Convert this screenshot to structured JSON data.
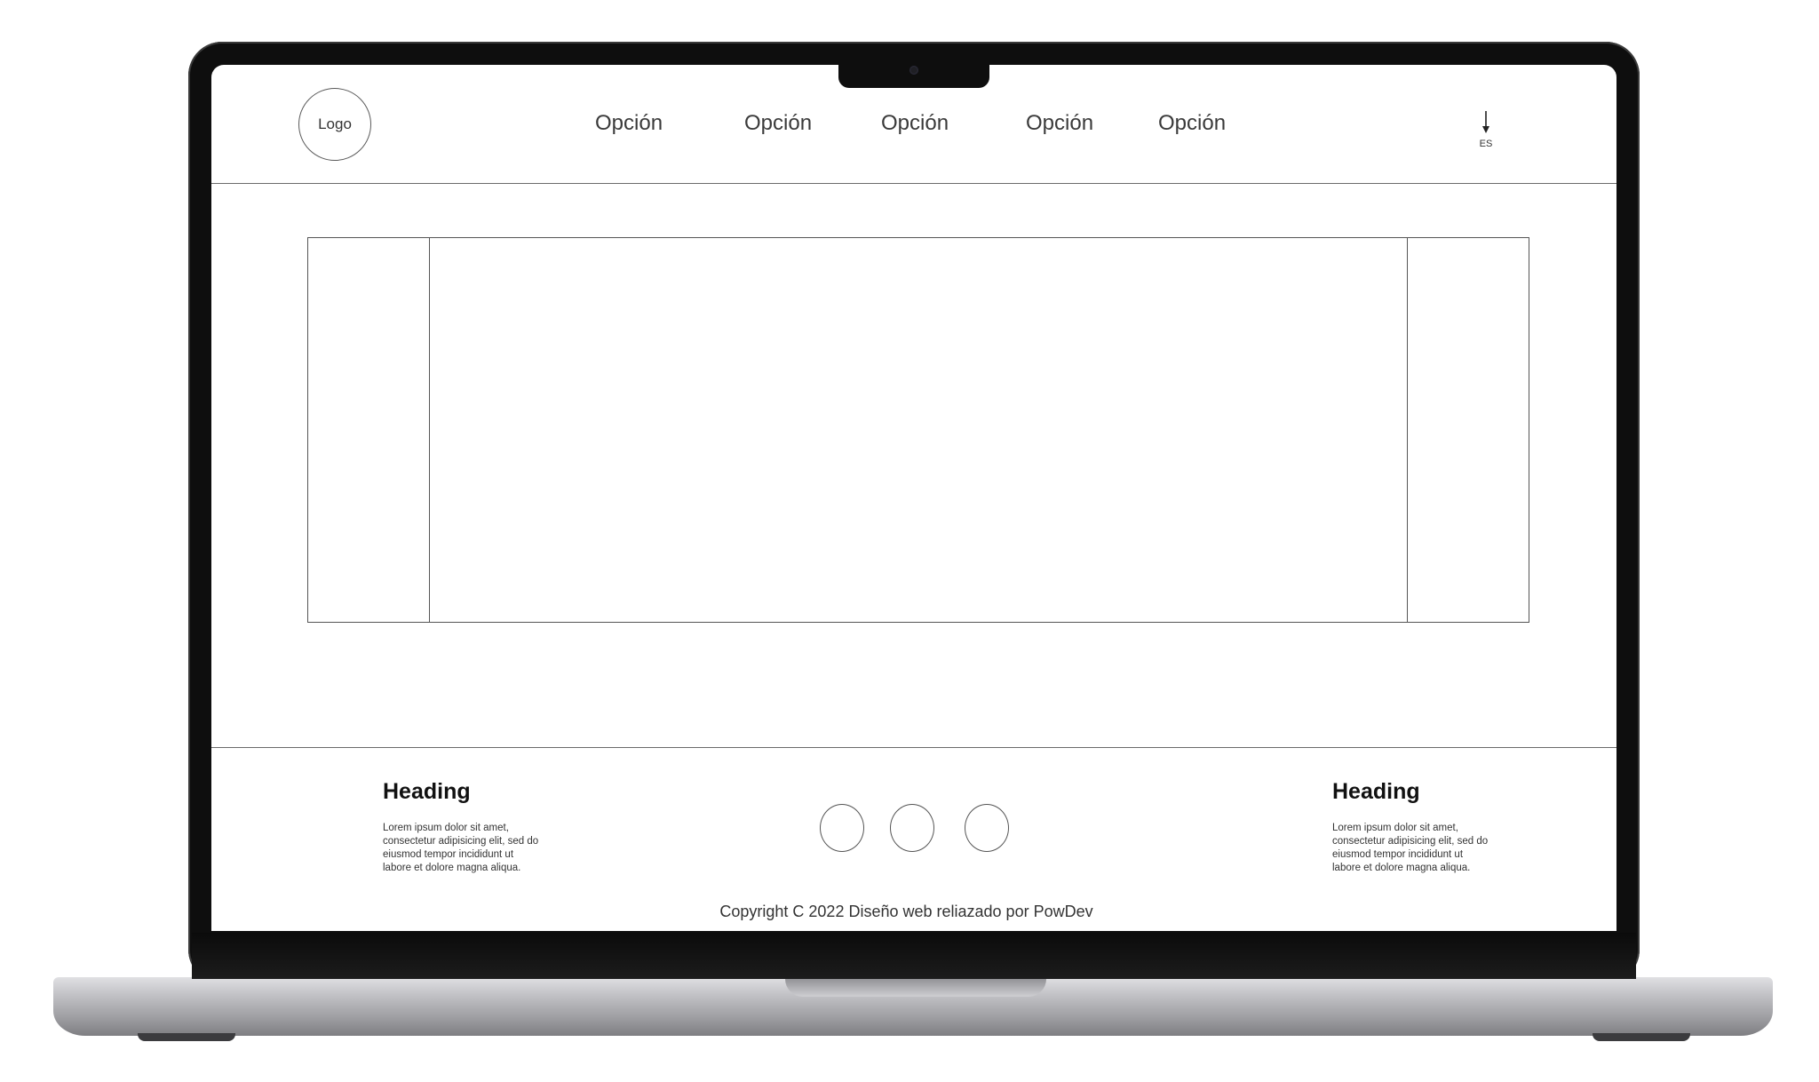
{
  "header": {
    "logo_text": "Logo",
    "nav": [
      "Opción",
      "Opción",
      "Opción",
      "Opción",
      "Opción"
    ],
    "language": {
      "label": "ES",
      "icon": "arrow-down-icon"
    }
  },
  "hero": {
    "prev_icon": "slider-prev-placeholder",
    "next_icon": "slider-next-placeholder"
  },
  "footer": {
    "left": {
      "heading": "Heading",
      "text": "Lorem ipsum dolor sit amet, consectetur adipisicing elit, sed do eiusmod tempor incididunt ut labore et dolore magna aliqua."
    },
    "right": {
      "heading": "Heading",
      "text": "Lorem ipsum dolor sit amet, consectetur adipisicing elit, sed do eiusmod tempor incididunt ut labore et dolore magna aliqua."
    },
    "social_icons": [
      "social-icon-placeholder",
      "social-icon-placeholder",
      "social-icon-placeholder"
    ],
    "copyright": "Copyright C 2022 Diseño web reliazado por PowDev"
  },
  "colors": {
    "bezel": "#0e0e0e",
    "laptop_base": "#b9b9bd",
    "wireframe_line": "#555555"
  }
}
